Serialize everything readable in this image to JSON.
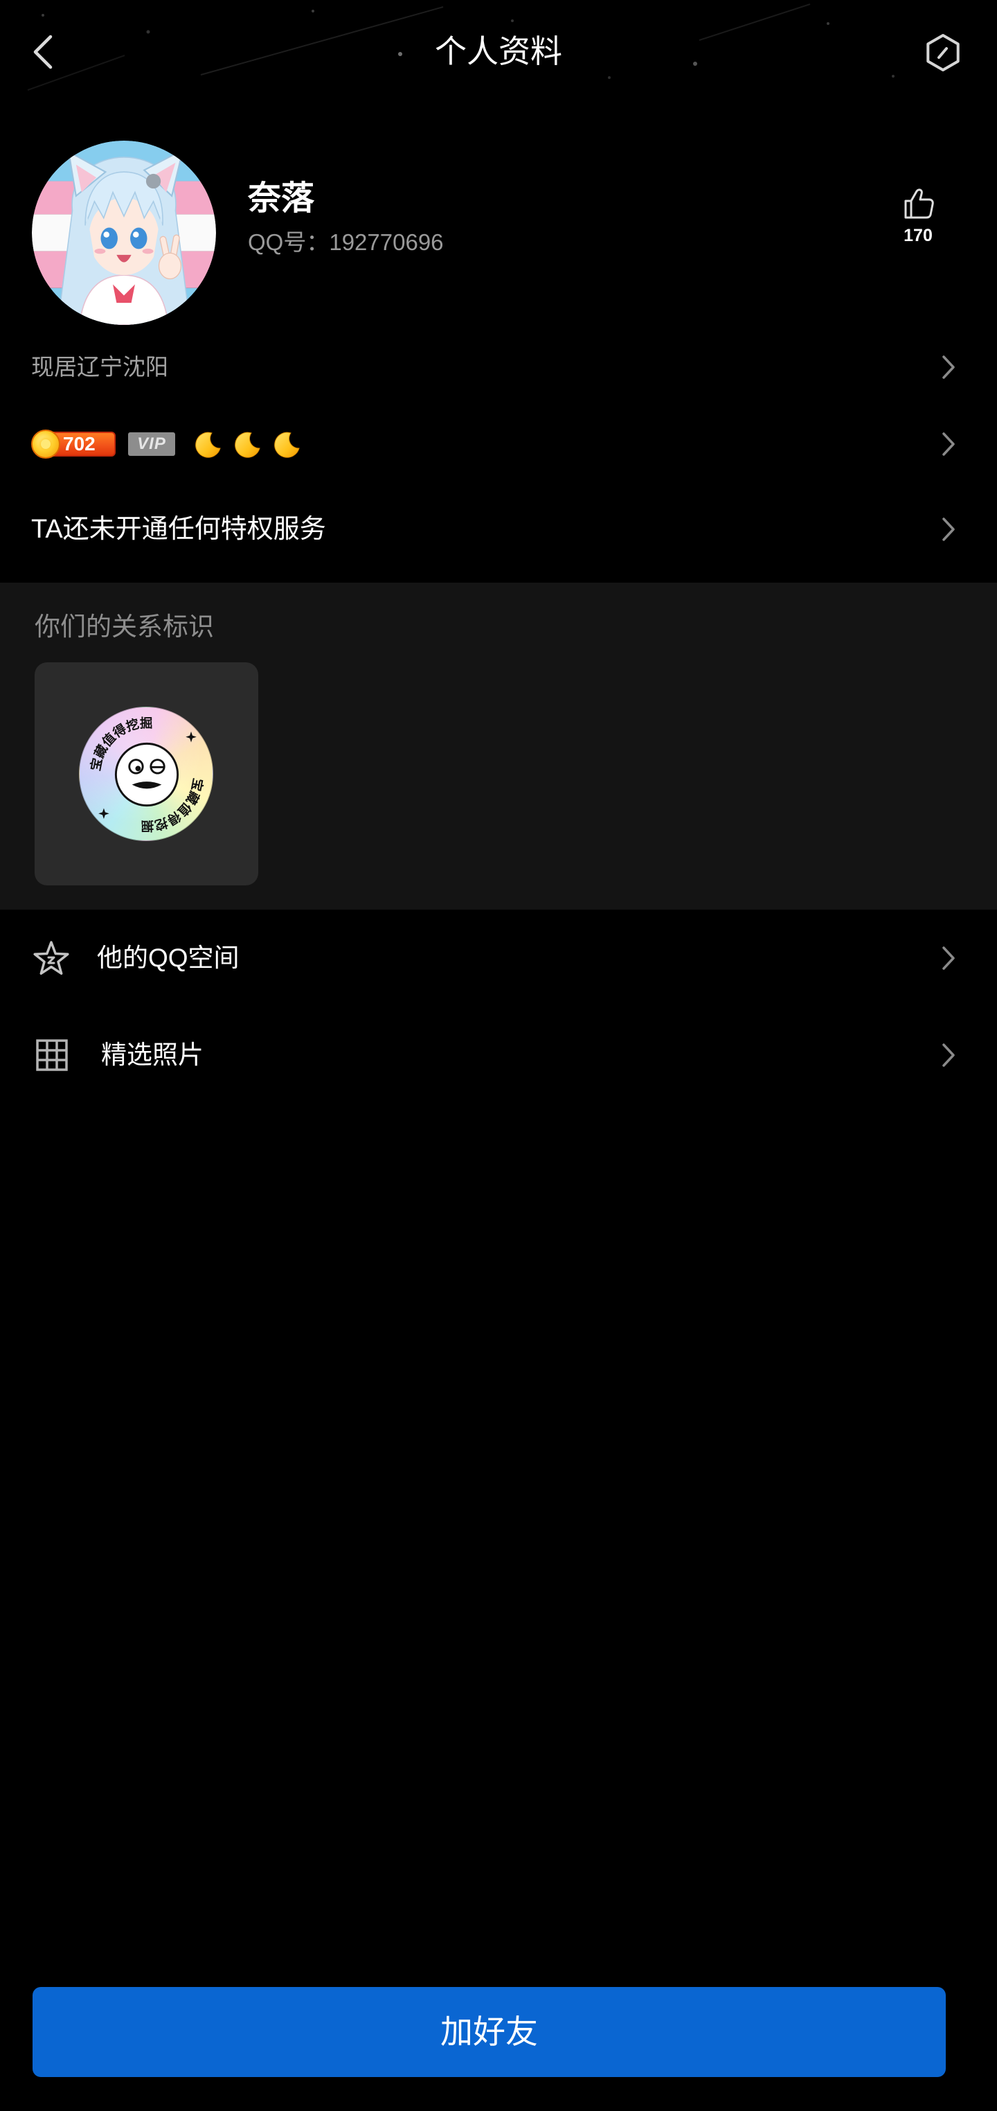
{
  "header": {
    "title": "个人资料",
    "back_icon": "chevron-left-icon",
    "more_icon": "hexagon-settings-icon"
  },
  "profile": {
    "name": "奈落",
    "qq_label": "QQ号：",
    "qq_number": "192770696",
    "likes_count": "170",
    "likes_icon": "thumbs-up-icon"
  },
  "location": {
    "text": "现居辽宁沈阳",
    "icon": "chevron-right-icon"
  },
  "level": {
    "badge_value": "702",
    "vip_label": "VIP",
    "moon_count": 3,
    "moon_icon": "moon-icon"
  },
  "privilege": {
    "text": "TA还未开通任何特权服务"
  },
  "relationship": {
    "title": "你们的关系标识",
    "badge_text": "宝藏值得挖掘"
  },
  "links": [
    {
      "label": "他的QQ空间",
      "icon": "star-icon"
    },
    {
      "label": "精选照片",
      "icon": "grid-icon"
    }
  ],
  "actions": {
    "add_friend_label": "加好友"
  },
  "colors": {
    "background": "#000000",
    "section_background": "#141414",
    "tile_background": "#2b2b2b",
    "secondary_text": "#9a9a9a",
    "primary_button": "#0a66d2",
    "level_badge": "#f2541a",
    "vip_badge_inactive": "#8d8d8d"
  }
}
